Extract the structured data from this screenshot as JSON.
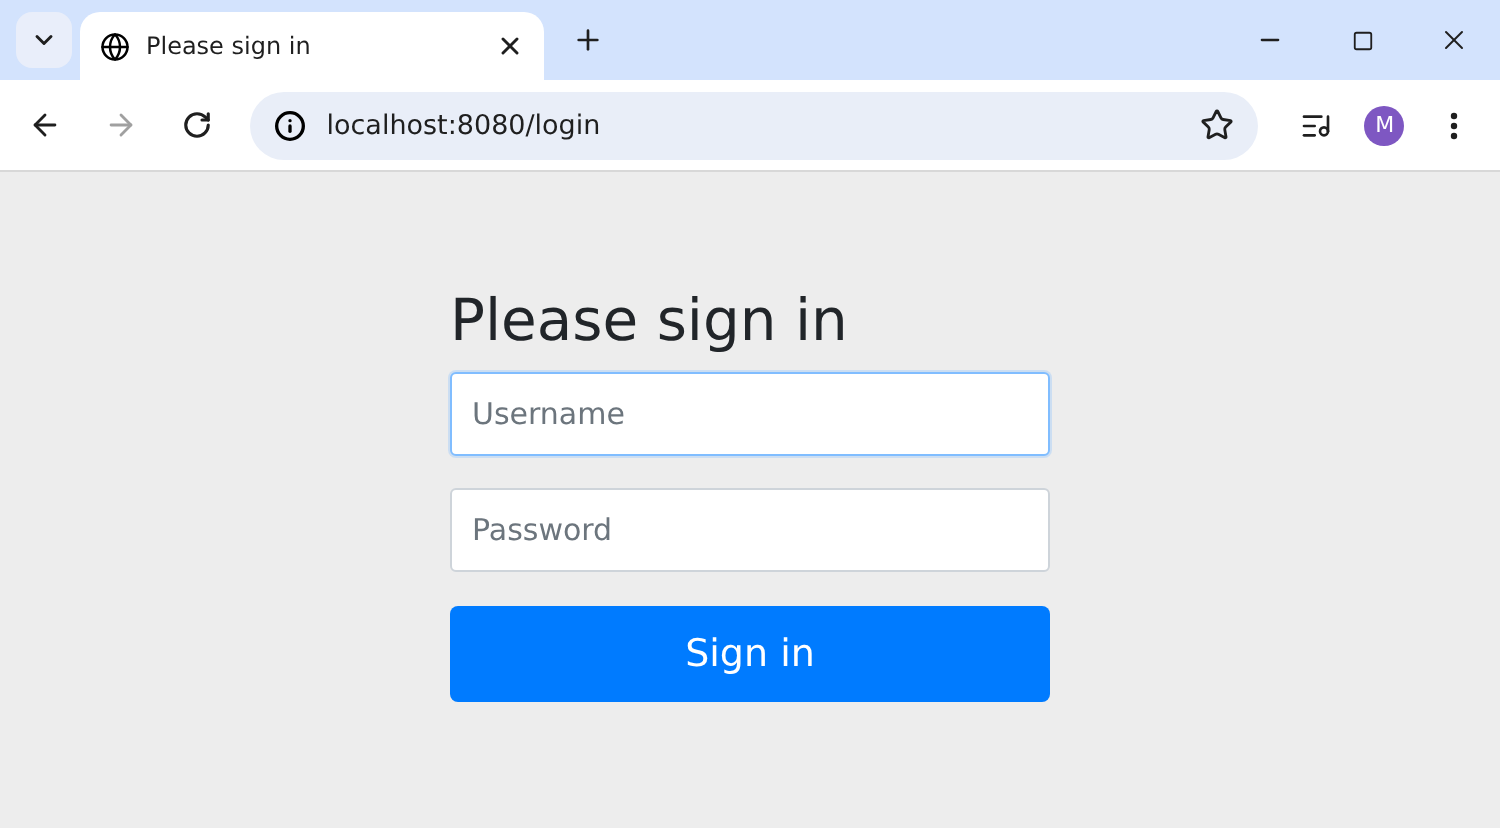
{
  "tab": {
    "title": "Please sign in",
    "selected": true
  },
  "address_bar": {
    "url": "localhost:8080/login"
  },
  "profile": {
    "initial": "M"
  },
  "form": {
    "heading": "Please sign in",
    "fields": [
      {
        "placeholder": "Username",
        "focused": true
      },
      {
        "placeholder": "Password",
        "focused": false
      }
    ],
    "button": "Sign in"
  }
}
